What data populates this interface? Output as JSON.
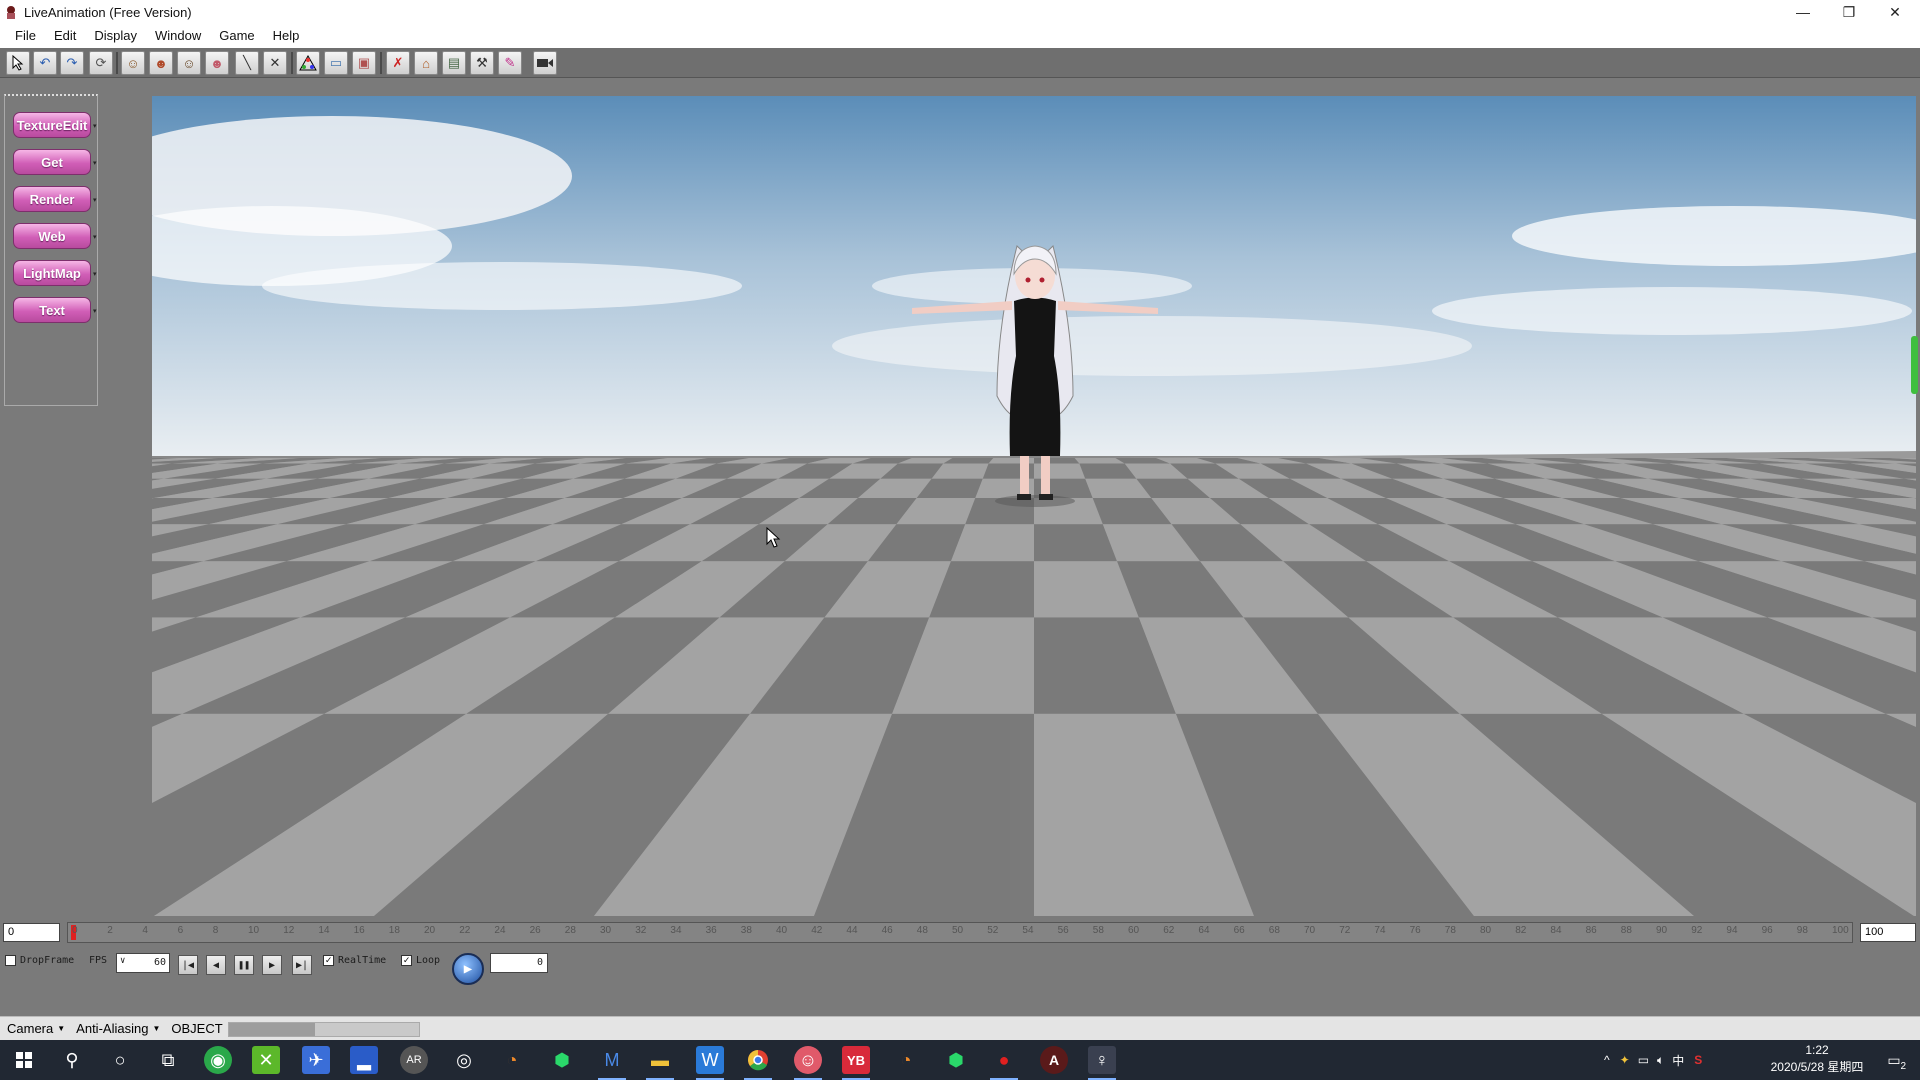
{
  "window": {
    "title": "LiveAnimation (Free Version)",
    "minimize": "—",
    "restore": "❐",
    "close": "✕"
  },
  "menu": [
    "File",
    "Edit",
    "Display",
    "Window",
    "Game",
    "Help"
  ],
  "toolbar_icons": [
    "select-arrow",
    "undo",
    "redo",
    "refresh",
    "character-1",
    "character-2",
    "character-3",
    "character-4",
    "line-tool",
    "delete-x",
    "color-chart",
    "window-frame",
    "camera-frame",
    "red-figure",
    "house",
    "landscape",
    "tools",
    "brush",
    "video-camera"
  ],
  "left_panel": {
    "buttons": [
      "TextureEdit",
      "Get",
      "Render",
      "Web",
      "LightMap",
      "Text"
    ]
  },
  "timeline": {
    "start_value": "0",
    "end_value": "100",
    "current_frame": 0,
    "ticks": [
      "0",
      "2",
      "4",
      "6",
      "8",
      "10",
      "12",
      "14",
      "16",
      "18",
      "20",
      "22",
      "24",
      "26",
      "28",
      "30",
      "32",
      "34",
      "36",
      "38",
      "40",
      "42",
      "44",
      "46",
      "48",
      "50",
      "52",
      "54",
      "56",
      "58",
      "60",
      "62",
      "64",
      "66",
      "68",
      "70",
      "72",
      "74",
      "76",
      "78",
      "80",
      "82",
      "84",
      "86",
      "88",
      "90",
      "92",
      "94",
      "96",
      "98",
      "100"
    ]
  },
  "playback": {
    "dropframe_label": "DropFrame",
    "dropframe_checked": false,
    "fps_label": "FPS",
    "fps_value": "60",
    "realtime_label": "RealTime",
    "realtime_checked": true,
    "loop_label": "Loop",
    "loop_checked": true,
    "frame_value": "0"
  },
  "statusbar": {
    "camera": "Camera",
    "antialiasing": "Anti-Aliasing",
    "mode": "OBJECT",
    "progress": 0.45
  },
  "taskbar": {
    "time": "1:22",
    "date": "2020/5/28 星期四",
    "ime": "中",
    "notifications": "2",
    "apps": [
      "start",
      "search",
      "cortana",
      "task-view",
      "green-app",
      "excel-like",
      "blue-bird",
      "blue-app",
      "dark-app",
      "obs",
      "blender",
      "green-hex",
      "word-m",
      "file-explorer",
      "w-app",
      "chrome",
      "pink-app",
      "yb-app",
      "blender-2",
      "green-hex-2",
      "record",
      "a-app",
      "live-animation"
    ]
  },
  "colors": {
    "accent_button": "#d15fb7",
    "toolbar_bg": "#6f6f6f",
    "taskbar_bg": "#212833",
    "progress_green": "#3fbf3f"
  }
}
